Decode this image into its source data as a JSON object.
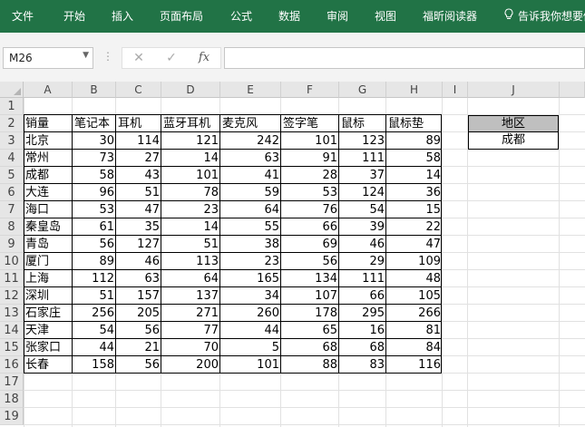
{
  "ribbon": {
    "tabs": [
      "文件",
      "开始",
      "插入",
      "页面布局",
      "公式",
      "数据",
      "审阅",
      "视图",
      "福昕阅读器"
    ],
    "tell_me": "告诉我你想要做"
  },
  "formula_bar": {
    "name_box": "M26",
    "cancel_glyph": "✕",
    "enter_glyph": "✓",
    "fx_label": "fx",
    "formula": ""
  },
  "sheet": {
    "columns": [
      "A",
      "B",
      "C",
      "D",
      "E",
      "F",
      "G",
      "H",
      "I",
      "J"
    ],
    "rows": [
      "1",
      "2",
      "3",
      "4",
      "5",
      "6",
      "7",
      "8",
      "9",
      "10",
      "11",
      "12",
      "13",
      "14",
      "15",
      "16",
      "17",
      "18",
      "19"
    ],
    "table": {
      "headers": [
        "销量",
        "笔记本",
        "耳机",
        "蓝牙耳机",
        "麦克风",
        "签字笔",
        "鼠标",
        "鼠标垫"
      ],
      "data": [
        [
          "北京",
          "30",
          "114",
          "121",
          "242",
          "101",
          "123",
          "89"
        ],
        [
          "常州",
          "73",
          "27",
          "14",
          "63",
          "91",
          "111",
          "58"
        ],
        [
          "成都",
          "58",
          "43",
          "101",
          "41",
          "28",
          "37",
          "14"
        ],
        [
          "大连",
          "96",
          "51",
          "78",
          "59",
          "53",
          "124",
          "36"
        ],
        [
          "海口",
          "53",
          "47",
          "23",
          "64",
          "76",
          "54",
          "15"
        ],
        [
          "秦皇岛",
          "61",
          "35",
          "14",
          "55",
          "66",
          "39",
          "22"
        ],
        [
          "青岛",
          "56",
          "127",
          "51",
          "38",
          "69",
          "46",
          "47"
        ],
        [
          "厦门",
          "89",
          "46",
          "113",
          "23",
          "56",
          "29",
          "109"
        ],
        [
          "上海",
          "112",
          "63",
          "64",
          "165",
          "134",
          "111",
          "48"
        ],
        [
          "深圳",
          "51",
          "157",
          "137",
          "34",
          "107",
          "66",
          "105"
        ],
        [
          "石家庄",
          "256",
          "205",
          "271",
          "260",
          "178",
          "295",
          "266"
        ],
        [
          "天津",
          "54",
          "56",
          "77",
          "44",
          "65",
          "16",
          "81"
        ],
        [
          "张家口",
          "44",
          "21",
          "70",
          "5",
          "68",
          "68",
          "84"
        ],
        [
          "长春",
          "158",
          "56",
          "200",
          "101",
          "88",
          "83",
          "116"
        ]
      ]
    },
    "region": {
      "header": "地区",
      "value": "成都"
    }
  },
  "colors": {
    "ribbon": "#217346",
    "header_fill": "#e6e6e6",
    "region_header_fill": "#bfbfbf"
  }
}
